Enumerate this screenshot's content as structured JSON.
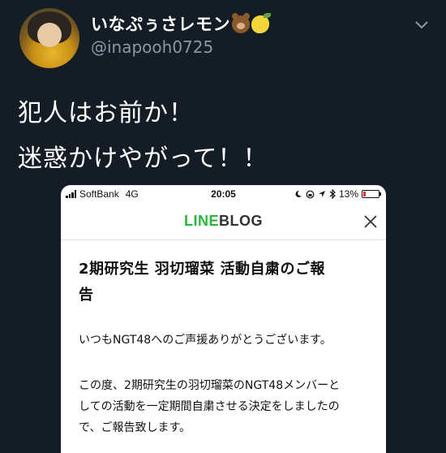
{
  "tweet": {
    "display_name": "いなぷぅさレモン",
    "display_name_emojis": [
      "bear-face-emoji",
      "lemon-emoji"
    ],
    "handle": "@inapooh0725",
    "menu_icon": "chevron-down-icon",
    "text_lines": [
      "犯人はお前か！",
      "迷惑かけやがって！！"
    ]
  },
  "embedded_screenshot": {
    "status_bar": {
      "carrier": "SoftBank",
      "network": "4G",
      "time": "20:05",
      "battery": "13%",
      "icons": [
        "moon-icon",
        "lock-rotation-icon",
        "location-arrow-icon",
        "bluetooth-icon",
        "battery-icon"
      ]
    },
    "header": {
      "brand_line": "LINE",
      "brand_blog": "BLOG",
      "close_icon": "close-icon"
    },
    "article": {
      "title_line1": "2期研究生 羽切瑠菜 活動自粛のご報",
      "title_line2": "告",
      "para1": "いつもNGT48へのご声援ありがとうございます。",
      "para2_line1": "この度、2期研究生の羽切瑠菜のNGT48メンバーと",
      "para2_line2": "しての活動を一定期間自粛させる決定をしましたの",
      "para2_line3": "で、ご報告致します。"
    }
  },
  "colors": {
    "background": "#141d26",
    "handle_gray": "#8899a6",
    "line_green": "#2bb53c",
    "battery_low": "#e0322e"
  }
}
